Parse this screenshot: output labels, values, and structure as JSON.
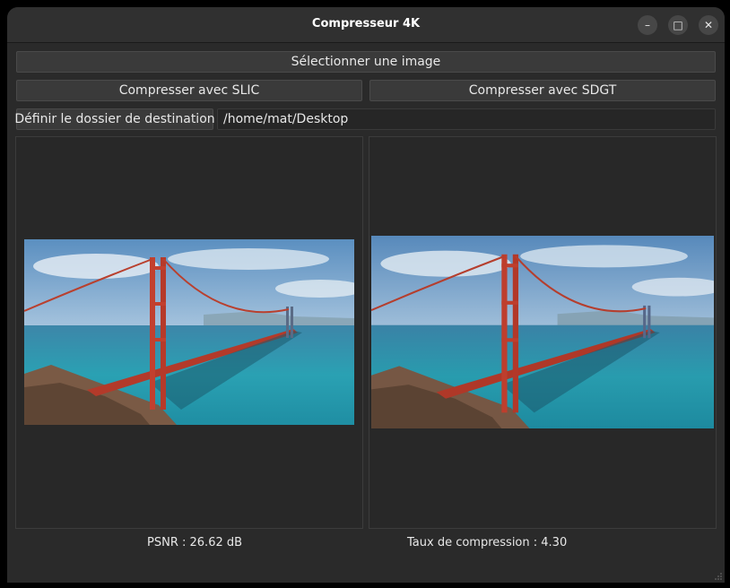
{
  "window": {
    "title": "Compresseur 4K",
    "controls": {
      "minimize": "–",
      "maximize": "□",
      "close": "✕"
    }
  },
  "actions": {
    "select_image": "Sélectionner une image",
    "compress_slic": "Compresser avec SLIC",
    "compress_sdgt": "Compresser avec SDGT",
    "set_destination": "Définir le dossier de destination"
  },
  "destination": {
    "path": "/home/mat/Desktop"
  },
  "stats": {
    "psnr_label": "PSNR :",
    "psnr_value": "26.62 dB",
    "ratio_label": "Taux de compression :",
    "ratio_value": "4.30"
  },
  "images": {
    "original_icon": "golden-gate-bridge-photo",
    "compressed_icon": "golden-gate-bridge-photo-compressed"
  }
}
